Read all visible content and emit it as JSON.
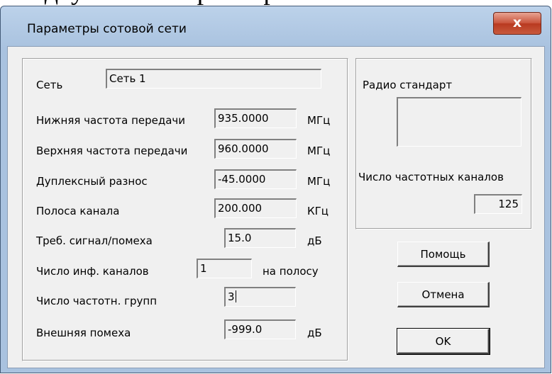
{
  "background_text": "ыпадку \"Сеть-Параметры\" число частотных",
  "window": {
    "title": "Параметры сотовой сети",
    "close_label": "x"
  },
  "network": {
    "label": "Сеть",
    "value": "Сеть 1"
  },
  "params": {
    "low_freq": {
      "label": "Нижняя частота передачи",
      "value": "935.0000",
      "unit": "МГц"
    },
    "high_freq": {
      "label": "Верхняя частота передачи",
      "value": "960.0000",
      "unit": "МГц"
    },
    "duplex": {
      "label": "Дуплексный разнос",
      "value": "-45.0000",
      "unit": "МГц"
    },
    "bandwidth": {
      "label": "Полоса канала",
      "value": "200.000",
      "unit": "КГц"
    },
    "snr": {
      "label": "Треб. сигнал/помеха",
      "value": "15.0",
      "unit": "дБ"
    },
    "info_channels": {
      "label": "Число инф. каналов",
      "value": "1",
      "unit": "на полосу"
    },
    "freq_groups": {
      "label": "Число частотн. групп",
      "value": "3"
    },
    "ext_noise": {
      "label": "Внешняя помеха",
      "value": "-999.0",
      "unit": "дБ"
    }
  },
  "radio": {
    "label": "Радио стандарт",
    "value": "",
    "channels_label": "Число частотных каналов",
    "channels_value": "125"
  },
  "buttons": {
    "help": "Помощь",
    "cancel": "Отмена",
    "ok": "OK"
  }
}
